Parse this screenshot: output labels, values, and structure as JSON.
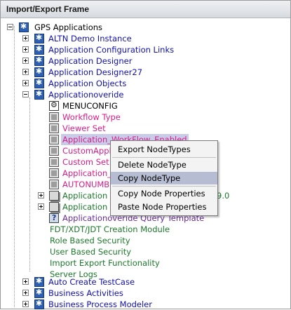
{
  "window": {
    "title": "Import/Export Frame"
  },
  "tree": {
    "root": {
      "label": "GPS Applications"
    },
    "level1_top": [
      {
        "label": "ALTN Demo Instance"
      },
      {
        "label": "Application Configuration Links"
      },
      {
        "label": "Application Designer"
      },
      {
        "label": "Application Designer27"
      },
      {
        "label": "Application Objects"
      },
      {
        "label": "Applicationoveride"
      }
    ],
    "children": [
      {
        "label": "MENUCONFIG"
      },
      {
        "label": "Workflow Type"
      },
      {
        "label": "Viewer Set"
      },
      {
        "label": "Application_WorkFlow_Enabled"
      },
      {
        "label": "CustomAppl"
      },
      {
        "label": "Custom Set"
      },
      {
        "label": "Application_"
      },
      {
        "label": "AUTONUMBE"
      },
      {
        "label": "Application I",
        "suffix": "9.0"
      },
      {
        "label": "Application S"
      },
      {
        "label": "Applicationoveride Query Template"
      },
      {
        "label": "FDT/XDT/JDT Creation Module"
      },
      {
        "label": "Role Based Security"
      },
      {
        "label": "User Based Security"
      },
      {
        "label": "Import Export Functionality"
      },
      {
        "label": "Server Logs"
      }
    ],
    "level1_bottom": [
      {
        "label": "Auto Create TestCase"
      },
      {
        "label": "Business Activities"
      },
      {
        "label": "Business Process Modeler"
      }
    ]
  },
  "context_menu": {
    "items": [
      {
        "label": "Export NodeTypes"
      },
      {
        "label": "Delete NodeType"
      },
      {
        "label": "Copy NodeType"
      },
      {
        "label": "Copy Node Properties"
      },
      {
        "label": "Paste Node Properties"
      }
    ],
    "highlighted": "Copy NodeType"
  }
}
